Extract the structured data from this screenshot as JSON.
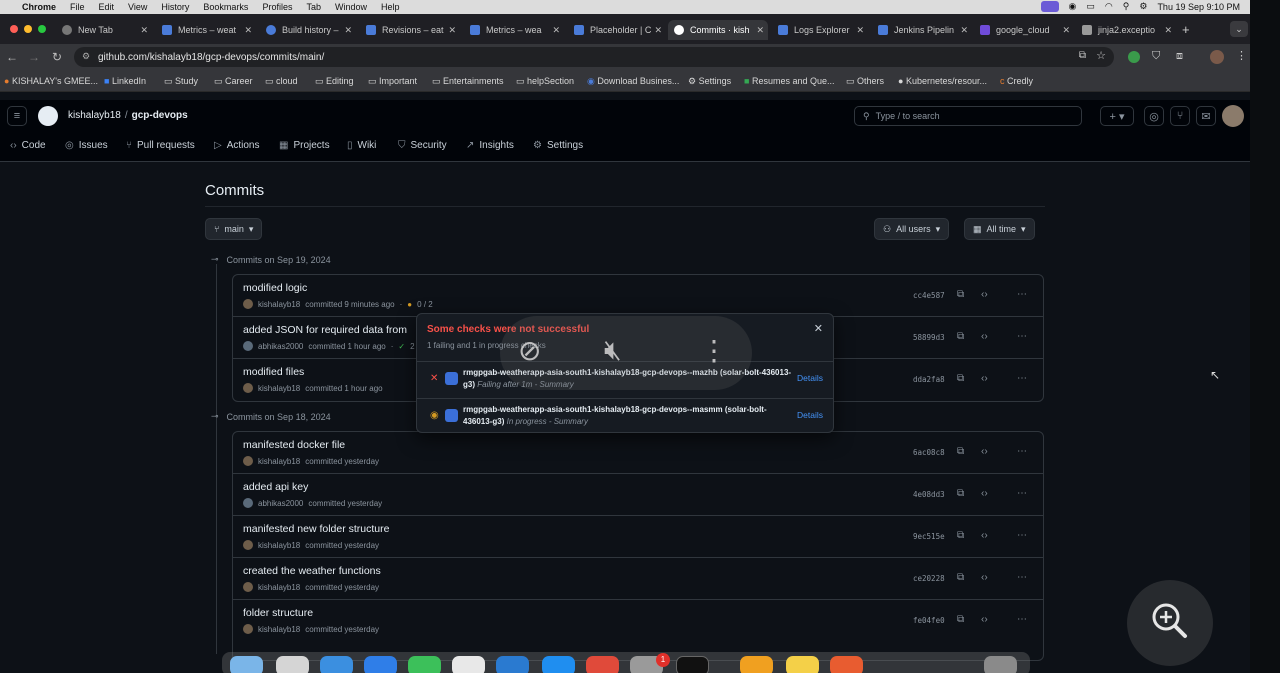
{
  "menubar": {
    "app": "Chrome",
    "items": [
      "File",
      "Edit",
      "View",
      "History",
      "Bookmarks",
      "Profiles",
      "Tab",
      "Window",
      "Help"
    ],
    "clock": "Thu 19 Sep  9:10 PM"
  },
  "tabs": [
    {
      "label": "New Tab"
    },
    {
      "label": "Metrics – weat"
    },
    {
      "label": "Build history –"
    },
    {
      "label": "Revisions – eat"
    },
    {
      "label": "Metrics – wea"
    },
    {
      "label": "Placeholder | C"
    },
    {
      "label": "Commits · kish"
    },
    {
      "label": "Logs Explorer"
    },
    {
      "label": "Jenkins Pipelin"
    },
    {
      "label": "google_cloud"
    },
    {
      "label": "jinja2.exceptio"
    }
  ],
  "address": "github.com/kishalayb18/gcp-devops/commits/main/",
  "bookmarks": [
    "KISHALAY's GMEE...",
    "LinkedIn",
    "Study",
    "Career",
    "cloud",
    "Editing",
    "Important",
    "Entertainments",
    "helpSection",
    "Download Busines...",
    "Settings",
    "Resumes and Que...",
    "Others",
    "Kubernetes/resour...",
    "Credly"
  ],
  "repo": {
    "owner": "kishalayb18",
    "name": "gcp-devops"
  },
  "search_placeholder": "Type / to search",
  "repo_nav": [
    "Code",
    "Issues",
    "Pull requests",
    "Actions",
    "Projects",
    "Wiki",
    "Security",
    "Insights",
    "Settings"
  ],
  "page_title": "Commits",
  "branch": "main",
  "filters": {
    "users": "All users",
    "time": "All time"
  },
  "groups": [
    {
      "heading": "Commits on Sep 19, 2024",
      "commits": [
        {
          "message": "modified logic",
          "author": "kishalayb18",
          "meta": "committed 9 minutes ago",
          "status": "0 / 2",
          "sha": "cc4e587"
        },
        {
          "message": "added JSON for required data from",
          "author": "abhikas2000",
          "meta": "committed 1 hour ago",
          "status": "2",
          "sha": "58899d3"
        },
        {
          "message": "modified files",
          "author": "kishalayb18",
          "meta": "committed 1 hour ago",
          "status": "",
          "sha": "dda2fa8"
        }
      ]
    },
    {
      "heading": "Commits on Sep 18, 2024",
      "commits": [
        {
          "message": "manifested docker file",
          "author": "kishalayb18",
          "meta": "committed yesterday",
          "status": "",
          "sha": "6ac08c8"
        },
        {
          "message": "added api key",
          "author": "abhikas2000",
          "meta": "committed yesterday",
          "status": "",
          "sha": "4e08dd3"
        },
        {
          "message": "manifested new folder structure",
          "author": "kishalayb18",
          "meta": "committed yesterday",
          "status": "",
          "sha": "9ec515e"
        },
        {
          "message": "created the weather functions",
          "author": "kishalayb18",
          "meta": "committed yesterday",
          "status": "",
          "sha": "ce20228"
        },
        {
          "message": "folder structure",
          "author": "kishalayb18",
          "meta": "committed yesterday",
          "status": "",
          "sha": "fe04fe0"
        }
      ]
    }
  ],
  "checks_popup": {
    "title": "Some checks were not successful",
    "subtitle": "1 failing and 1 in progress checks",
    "checks": [
      {
        "name": "rmgpgab-weatherapp-asia-south1-kishalayb18-gcp-devops--mazhb (solar-bolt-436013-g3)",
        "summary": "Failing after 1m - Summary",
        "status": "failing",
        "details": "Details"
      },
      {
        "name": "rmgpgab-weatherapp-asia-south1-kishalayb18-gcp-devops--masmm (solar-bolt-436013-g3)",
        "summary": "In progress - Summary",
        "status": "in_progress",
        "details": "Details"
      }
    ]
  },
  "colors": {
    "accent": "#4493f8",
    "danger": "#f85149",
    "pending": "#d29922",
    "bg": "#0d1117"
  }
}
